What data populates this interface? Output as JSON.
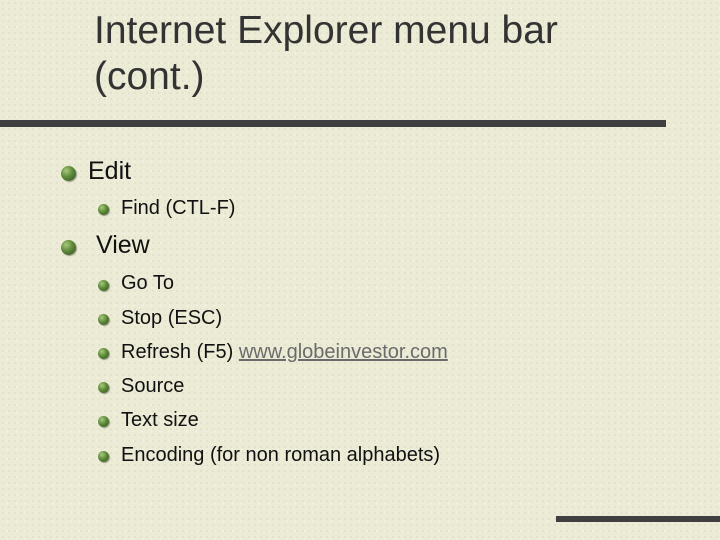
{
  "slide": {
    "title_line1": "Internet Explorer menu bar",
    "title_line2": "(cont.)",
    "sections": [
      {
        "label": "Edit",
        "items": [
          "Find (CTL-F)"
        ]
      },
      {
        "label": "View",
        "items": [
          "Go To",
          "Stop  (ESC)",
          "Refresh  (F5)",
          "Source",
          "Text size",
          "Encoding (for non roman alphabets)"
        ],
        "link": "www.globeinvestor.com"
      }
    ]
  },
  "colors": {
    "background": "#ecebd6",
    "rule": "#3f3f3f",
    "bullet": "#5e8a3a",
    "link": "#6b6b6b"
  }
}
